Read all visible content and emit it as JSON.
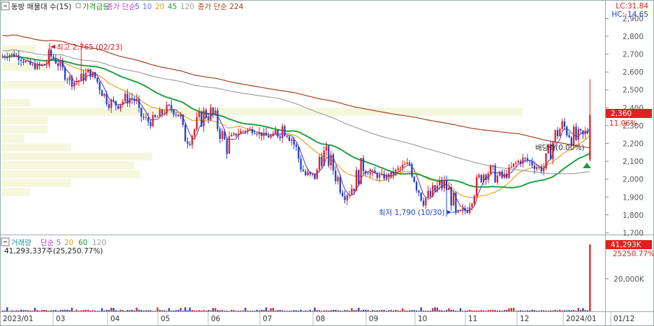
{
  "header": {
    "title": "동방 매물대 수(15)",
    "legend": [
      {
        "text": "가격급등",
        "color": "#2a8a2a"
      },
      {
        "text": "종가 단순",
        "color": "#c040c0"
      },
      {
        "text": "5",
        "color": "#5050d0"
      },
      {
        "text": "10",
        "color": "#7070e0"
      },
      {
        "text": "20",
        "color": "#e0a020"
      },
      {
        "text": "45",
        "color": "#20a040"
      },
      {
        "text": "120",
        "color": "#a0a0a0"
      },
      {
        "text": "종가 단순 224",
        "color": "#a04020"
      }
    ],
    "lc": "LC:31.84",
    "hc": "HC:-14.65"
  },
  "volume_header": {
    "title": "거래량",
    "ma": [
      {
        "text": "단순 5",
        "color": "#c040c0"
      },
      {
        "text": "20",
        "color": "#e0a020"
      },
      {
        "text": "60",
        "color": "#20a040"
      },
      {
        "text": "120",
        "color": "#a0a0a0"
      }
    ],
    "summary": "41,293,337주(25,250.77%)"
  },
  "annotations": {
    "high": "최고 2,765 (02/23)",
    "low": "최저 1,790 (10/30)",
    "dividend": "배당락(0.00%)"
  },
  "price_tag": {
    "value": "2,360",
    "change": "11.06%"
  },
  "volume_tag": {
    "value": "41,293K",
    "change": "25250.77%"
  },
  "colors": {
    "up": "#e02020",
    "down": "#2040d0",
    "ma5": "#7050c0",
    "ma20": "#e8a020",
    "ma45": "#20a040",
    "ma120": "#a0a0a0",
    "ma224": "#a04020",
    "volume_profile": "#f4f7dc"
  },
  "chart_data": {
    "type": "candlestick",
    "title": "동방 매물대 수(15)",
    "y_axis": {
      "ticks": [
        1700,
        1800,
        1900,
        2000,
        2100,
        2200,
        2300,
        2400,
        2500,
        2600,
        2700,
        2800,
        2900
      ],
      "tick_labels": [
        "1,700",
        "1,800",
        "1,900",
        "2,000",
        "2,100",
        "2,200",
        "2,300",
        "2,400",
        "2,500",
        "2,600",
        "2,700",
        "2,800",
        "2,900"
      ],
      "range": [
        1690,
        2925
      ]
    },
    "volume_axis": {
      "ticks": [
        20000
      ],
      "tick_labels": [
        "20,000K"
      ],
      "range": [
        0,
        41293
      ]
    },
    "x_axis": {
      "labels": [
        "2023/01",
        "03",
        "04",
        "05",
        "06",
        "07",
        "08",
        "09",
        "10",
        "11",
        "12",
        "2024/01",
        "01/12"
      ]
    },
    "monthly_ohlc": [
      {
        "month": "2023/01",
        "open": 2680,
        "high": 2720,
        "low": 2580,
        "close": 2650
      },
      {
        "month": "2023/02",
        "open": 2650,
        "high": 2765,
        "low": 2500,
        "close": 2560
      },
      {
        "month": "2023/03",
        "open": 2560,
        "high": 2600,
        "low": 2300,
        "close": 2380
      },
      {
        "month": "2023/04",
        "open": 2380,
        "high": 2500,
        "low": 2250,
        "close": 2340
      },
      {
        "month": "2023/05",
        "open": 2340,
        "high": 2520,
        "low": 2040,
        "close": 2250
      },
      {
        "month": "2023/06",
        "open": 2250,
        "high": 2320,
        "low": 2200,
        "close": 2260
      },
      {
        "month": "2023/07",
        "open": 2260,
        "high": 2490,
        "low": 2000,
        "close": 2050
      },
      {
        "month": "2023/08",
        "open": 2050,
        "high": 2310,
        "low": 1810,
        "close": 2020
      },
      {
        "month": "2023/09",
        "open": 2020,
        "high": 2120,
        "low": 1980,
        "close": 2060
      },
      {
        "month": "2023/10",
        "open": 2060,
        "high": 2270,
        "low": 1790,
        "close": 1830
      },
      {
        "month": "2023/11",
        "open": 1830,
        "high": 2180,
        "low": 1800,
        "close": 2040
      },
      {
        "month": "2023/12",
        "open": 2040,
        "high": 2210,
        "low": 2000,
        "close": 2100
      },
      {
        "month": "2024/01",
        "open": 2100,
        "high": 2560,
        "low": 2050,
        "close": 2360
      }
    ],
    "last_close": 2360,
    "high": 2765,
    "low": 1790
  }
}
